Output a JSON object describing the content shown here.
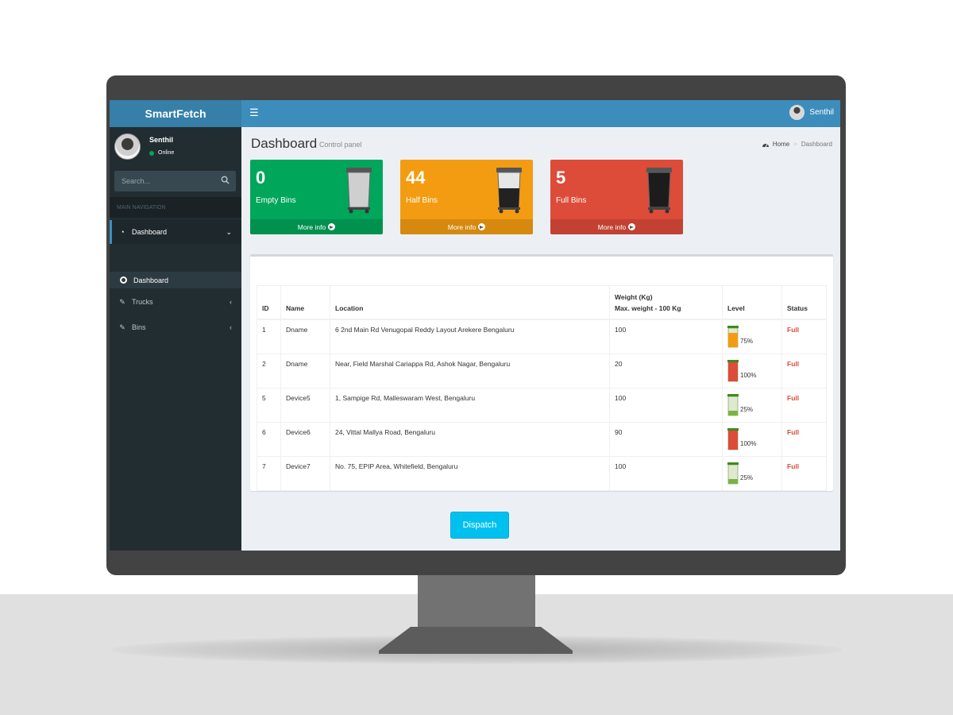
{
  "app": {
    "title": "SmartFetch"
  },
  "topbar": {
    "menu_icon": "hamburger-icon",
    "user_name": "Senthil"
  },
  "sidebar": {
    "user": {
      "name": "Senthil",
      "status": "Online",
      "status_color": "#00a65a"
    },
    "search_placeholder": "Search...",
    "nav_header": "MAIN NAVIGATION",
    "items": [
      {
        "label": "Dashboard",
        "icon": "dashboard-icon",
        "expanded": true
      },
      {
        "label": "Dashboard",
        "icon": "circle-icon",
        "sub": true
      },
      {
        "label": "Trucks",
        "icon": "edit-icon"
      },
      {
        "label": "Bins",
        "icon": "edit-icon"
      }
    ]
  },
  "page": {
    "title": "Dashboard",
    "subtitle": "Control panel",
    "breadcrumb": [
      "Home",
      "Dashboard"
    ]
  },
  "stats": [
    {
      "value": "0",
      "label": "Empty Bins",
      "link": "More info",
      "color": "#00a65a",
      "fill": 0.0
    },
    {
      "value": "44",
      "label": "Half Bins",
      "link": "More info",
      "color": "#f39c12",
      "fill": 0.5
    },
    {
      "value": "5",
      "label": "Full Bins",
      "link": "More info",
      "color": "#dd4b39",
      "fill": 1.0
    }
  ],
  "table": {
    "headers": {
      "id": "ID",
      "name": "Name",
      "location": "Location",
      "weight1": "Weight (Kg)",
      "weight2": "Max. weight - 100 Kg",
      "level": "Level",
      "status": "Status"
    },
    "rows": [
      {
        "id": "1",
        "name": "Dname",
        "location": "6 2nd Main Rd Venugopal Reddy Layout Arekere Bengaluru",
        "weight": "100",
        "level": "75%",
        "level_color": "#f39c12",
        "status": "Full"
      },
      {
        "id": "2",
        "name": "Dname",
        "location": "Near, Field Marshal Cariappa Rd, Ashok Nagar, Bengaluru",
        "weight": "20",
        "level": "100%",
        "level_color": "#dd4b39",
        "status": "Full"
      },
      {
        "id": "5",
        "name": "Device5",
        "location": "1, Sampige Rd, Malleswaram West, Bengaluru",
        "weight": "100",
        "level": "25%",
        "level_color": "#7cb342",
        "status": "Full"
      },
      {
        "id": "6",
        "name": "Device6",
        "location": "24, Vittal Mallya Road, Bengaluru",
        "weight": "90",
        "level": "100%",
        "level_color": "#dd4b39",
        "status": "Full"
      },
      {
        "id": "7",
        "name": "Device7",
        "location": "No. 75, EPIP Area, Whitefield, Bengaluru",
        "weight": "100",
        "level": "25%",
        "level_color": "#7cb342",
        "status": "Full"
      }
    ]
  },
  "dispatch_label": "Dispatch"
}
